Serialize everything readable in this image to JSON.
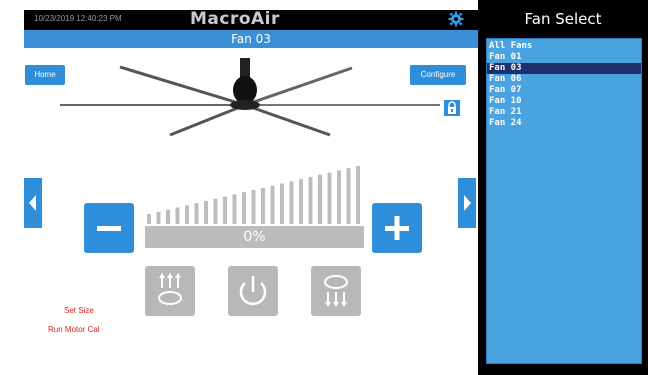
{
  "header": {
    "datetime": "10/23/2019 12:40:23 PM",
    "logo": "MacroAir",
    "title": "Fan 03"
  },
  "buttons": {
    "home": "Home",
    "configure": "Configure"
  },
  "speed": {
    "label": "0%",
    "value_percent": 0
  },
  "links": {
    "set_size": "Set Size",
    "run_motor_cal": "Run Motor Cal"
  },
  "sidebar": {
    "title": "Fan Select",
    "items": [
      {
        "label": "All Fans",
        "selected": false
      },
      {
        "label": "Fan 01",
        "selected": false
      },
      {
        "label": "Fan 03",
        "selected": true
      },
      {
        "label": "Fan 06",
        "selected": false
      },
      {
        "label": "Fan 07",
        "selected": false
      },
      {
        "label": "Fan 10",
        "selected": false
      },
      {
        "label": "Fan 21",
        "selected": false
      },
      {
        "label": "Fan 24",
        "selected": false
      }
    ]
  },
  "icons": {
    "settings": "gear-icon",
    "lock": "lock-icon",
    "prev": "chevron-left-icon",
    "next": "chevron-right-icon",
    "minus": "minus-icon",
    "plus": "plus-icon",
    "forward": "forward-rotation-icon",
    "power": "power-icon",
    "reverse": "reverse-rotation-icon"
  },
  "colors": {
    "accent": "#2e8ed9",
    "title_bar": "#3a8fd6",
    "selected_item": "#1e2f6e",
    "list_bg": "#4aa3df",
    "disabled_button": "#b8b8b8",
    "warning_text": "#dd2222"
  }
}
